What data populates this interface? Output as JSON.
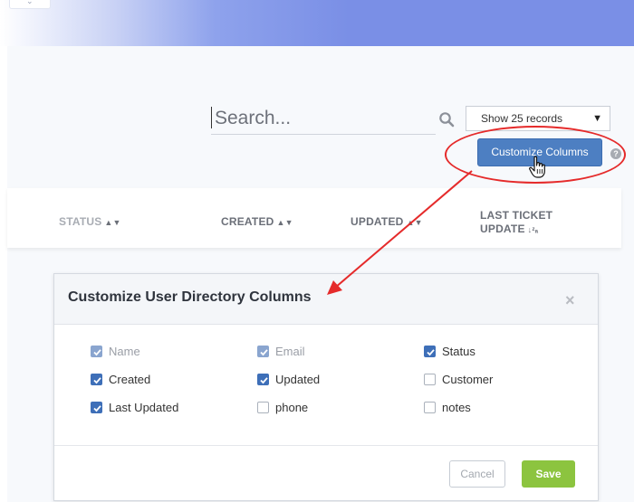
{
  "search": {
    "placeholder": "Search..."
  },
  "records_select": {
    "selected": "Show 25 records"
  },
  "toolbar": {
    "customize_label": "Customize Columns",
    "help": "?"
  },
  "table_header": {
    "columns": [
      {
        "label": "STATUS"
      },
      {
        "label": "CREATED"
      },
      {
        "label": "UPDATED"
      },
      {
        "label_line1": "LAST TICKET",
        "label_line2": "UPDATE"
      }
    ]
  },
  "modal": {
    "title": "Customize User Directory Columns",
    "close": "×",
    "options": [
      {
        "label": "Name",
        "checked": true,
        "disabled": true
      },
      {
        "label": "Email",
        "checked": true,
        "disabled": true
      },
      {
        "label": "Status",
        "checked": true,
        "disabled": false
      },
      {
        "label": "Created",
        "checked": true,
        "disabled": false
      },
      {
        "label": "Updated",
        "checked": true,
        "disabled": false
      },
      {
        "label": "Customer",
        "checked": false,
        "disabled": false
      },
      {
        "label": "Last Updated",
        "checked": true,
        "disabled": false
      },
      {
        "label": "phone",
        "checked": false,
        "disabled": false
      },
      {
        "label": "notes",
        "checked": false,
        "disabled": false
      }
    ],
    "cancel_label": "Cancel",
    "save_label": "Save"
  },
  "colors": {
    "primary_button": "#4d7fc2",
    "save_button": "#8cc43f",
    "highlight": "#e52b2b",
    "checkbox": "#3e6fb8"
  }
}
